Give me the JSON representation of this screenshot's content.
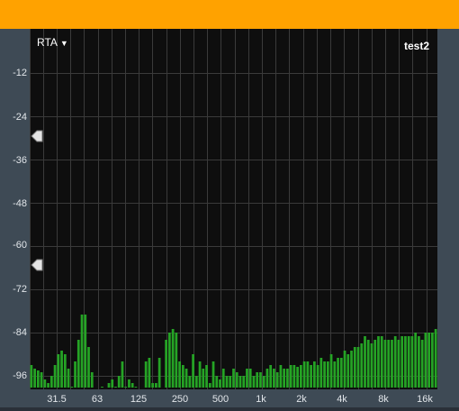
{
  "header": {},
  "rta": {
    "mode_label": "RTA",
    "dropdown_icon": "caret-down-icon",
    "preset_name": "test2"
  },
  "y_axis": {
    "ticks": [
      "-12",
      "-24",
      "-36",
      "-48",
      "-60",
      "-72",
      "-84",
      "-96"
    ]
  },
  "x_axis": {
    "ticks": [
      "31.5",
      "63",
      "125",
      "250",
      "500",
      "1k",
      "2k",
      "4k",
      "8k",
      "16k"
    ]
  },
  "markers": [
    {
      "icon": "left-pointer-icon",
      "level_db": -30
    },
    {
      "icon": "left-pointer-icon",
      "level_db": -66
    }
  ],
  "colors": {
    "header": "#ffa200",
    "bar": "#25a325",
    "plot_background": "#0e0e0e",
    "panel": "#3e4a55"
  },
  "chart_data": {
    "type": "bar",
    "x_scale": "log",
    "x_tick_values": [
      31.5,
      63,
      125,
      250,
      500,
      1000,
      2000,
      4000,
      8000,
      16000
    ],
    "y_tick_values": [
      -12,
      -24,
      -36,
      -48,
      -60,
      -72,
      -84,
      -96
    ],
    "ylim": [
      -100,
      0
    ],
    "grid": true,
    "values": [
      -93,
      -94,
      -94.5,
      -95,
      -97,
      -98,
      -96,
      -93,
      -90,
      -89,
      -90,
      -94,
      -99,
      -92,
      -86,
      -79,
      -79,
      -88,
      -95,
      -110,
      -110,
      -99,
      -99.5,
      -98,
      -97,
      -99,
      -96,
      -92,
      -99,
      -97,
      -98,
      -99,
      -110,
      -110,
      -92,
      -91,
      -98,
      -98,
      -91,
      -110,
      -86,
      -84,
      -83,
      -84,
      -92,
      -93,
      -94,
      -96,
      -90,
      -96,
      -92,
      -94,
      -93,
      -98,
      -92,
      -96,
      -97,
      -94,
      -96,
      -96,
      -94,
      -95,
      -96,
      -96,
      -94,
      -94,
      -96,
      -95,
      -95,
      -96,
      -94,
      -93,
      -94,
      -95,
      -93,
      -94,
      -94,
      -93,
      -93,
      -93.5,
      -93,
      -92,
      -92,
      -93,
      -92,
      -93,
      -91,
      -92,
      -92,
      -90,
      -92,
      -91,
      -91,
      -89,
      -90,
      -89,
      -88,
      -88,
      -87,
      -85,
      -86,
      -87,
      -86,
      -85,
      -85,
      -86,
      -86,
      -86,
      -85,
      -86,
      -85,
      -85,
      -85,
      -85,
      -84,
      -85,
      -86,
      -84,
      -84,
      -84,
      -83
    ]
  }
}
